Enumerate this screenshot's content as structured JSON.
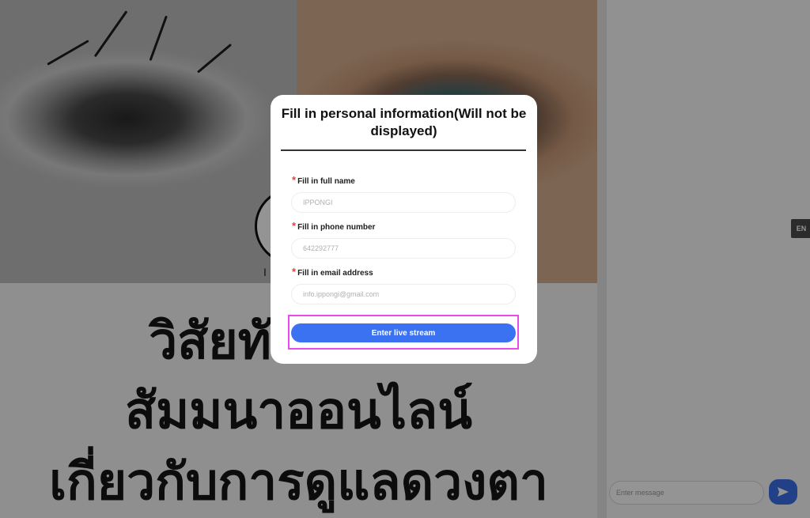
{
  "modal": {
    "title": "Fill in personal information(Will not be displayed)",
    "fields": [
      {
        "label": "Fill in full name",
        "required_mark": "*",
        "placeholder": "IPPONGI"
      },
      {
        "label": "Fill in phone number",
        "required_mark": "*",
        "placeholder": "642292777"
      },
      {
        "label": "Fill in email address",
        "required_mark": "*",
        "placeholder": "info.ippongi@gmail.com"
      }
    ],
    "submit_label": "Enter live stream"
  },
  "background": {
    "headline_lines": [
      "วิสัยทัศน์ใน                   ม",
      "สัมมนาออนไลน์",
      "เกี่ยวกับการดูแลดวงตา"
    ],
    "avatar_caption": "I"
  },
  "side_panel": {
    "language_badge": "EN",
    "message_placeholder": "Enter message",
    "send_icon": "send-icon"
  },
  "colors": {
    "accent": "#3b72f2",
    "required": "#e0443c",
    "highlight": "#e84be8"
  }
}
